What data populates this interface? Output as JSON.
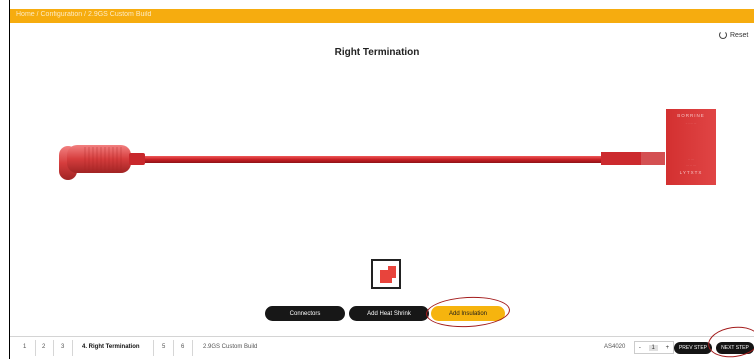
{
  "header": {
    "breadcrumb": "Home / Configuration / 2.9GS Custom Build",
    "reset_label": "Reset"
  },
  "main": {
    "title": "Right Termination"
  },
  "component_labels": {
    "end_text_top": "BORRINE",
    "end_text_bottom": "LYTXTX"
  },
  "actions": {
    "connectors": "Connectors",
    "add_heat_shrink": "Add Heat Shrink",
    "add_insulation": "Add Insulation"
  },
  "footer": {
    "steps": [
      {
        "label": "1"
      },
      {
        "label": "2"
      },
      {
        "label": "3"
      },
      {
        "label": "4. Right Termination"
      },
      {
        "label": "5"
      },
      {
        "label": "6"
      }
    ],
    "build_name": "2.9GS Custom Build",
    "part_number": "AS4020",
    "quantity": "1",
    "qty_minus": "-",
    "qty_plus": "+",
    "prev_step": "PREV STEP",
    "next_step": "NEXT STEP"
  },
  "colors": {
    "brand": "#f6ac0f",
    "cable_red": "#d2262c",
    "annotation": "#a31b1b"
  }
}
